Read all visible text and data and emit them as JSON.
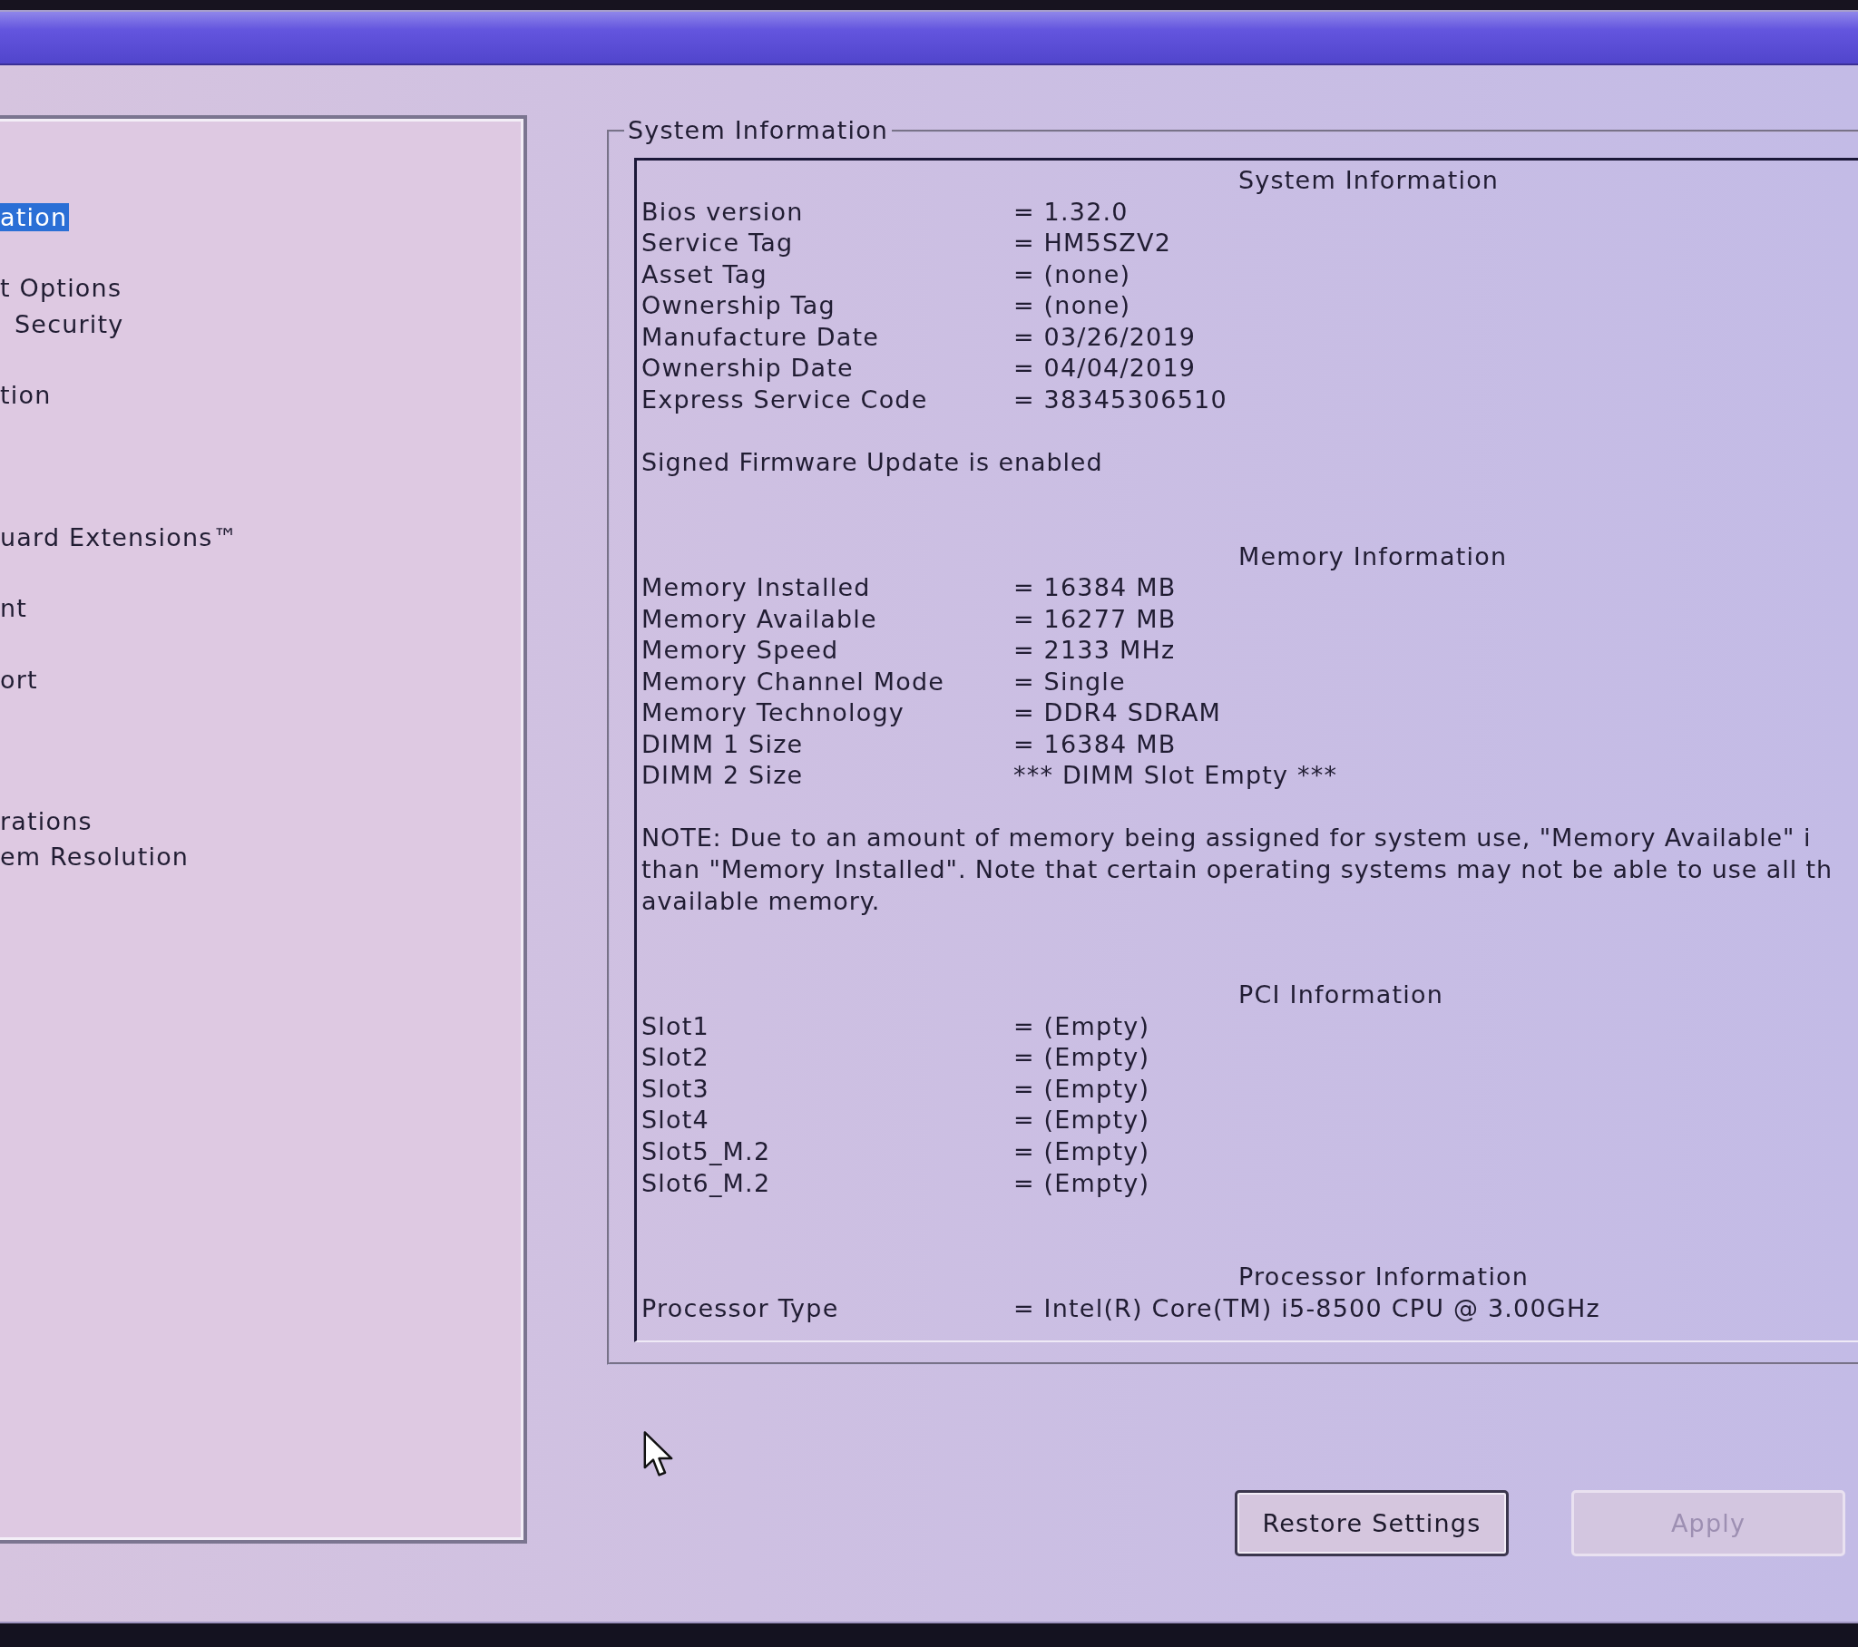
{
  "sidebar": {
    "items": [
      {
        "label": "ation",
        "selected": true
      },
      {
        "label": "t Options",
        "selected": false
      },
      {
        "label": "Security",
        "selected": false
      },
      {
        "label": "tion",
        "selected": false
      },
      {
        "label": "uard Extensions™",
        "selected": false
      },
      {
        "label": "nt",
        "selected": false
      },
      {
        "label": "ort",
        "selected": false
      },
      {
        "label": "rations",
        "selected": false
      },
      {
        "label": "em Resolution",
        "selected": false
      }
    ]
  },
  "group_box": {
    "title": "System Information",
    "sections": [
      {
        "title": "System Information",
        "rows": [
          {
            "label": "Bios version",
            "value": "= 1.32.0"
          },
          {
            "label": "Service Tag",
            "value": "= HM5SZV2"
          },
          {
            "label": "Asset Tag",
            "value": "= (none)"
          },
          {
            "label": "Ownership Tag",
            "value": "= (none)"
          },
          {
            "label": "Manufacture Date",
            "value": "= 03/26/2019"
          },
          {
            "label": "Ownership Date",
            "value": "= 04/04/2019"
          },
          {
            "label": "Express Service Code",
            "value": "= 38345306510"
          }
        ],
        "note": "Signed Firmware Update is enabled"
      },
      {
        "title": "Memory Information",
        "rows": [
          {
            "label": "Memory Installed",
            "value": "= 16384 MB"
          },
          {
            "label": "Memory Available",
            "value": "= 16277 MB"
          },
          {
            "label": "Memory Speed",
            "value": "= 2133 MHz"
          },
          {
            "label": "Memory Channel Mode",
            "value": "= Single"
          },
          {
            "label": "Memory Technology",
            "value": "= DDR4 SDRAM"
          },
          {
            "label": "DIMM 1 Size",
            "value": "= 16384 MB"
          },
          {
            "label": "DIMM 2 Size",
            "value": "*** DIMM Slot Empty ***"
          }
        ],
        "note": "NOTE: Due to an amount of memory being assigned for system use, \"Memory Available\" i\nthan \"Memory Installed\". Note that certain operating systems may not be able to use all th\navailable memory."
      },
      {
        "title": "PCI Information",
        "rows": [
          {
            "label": "Slot1",
            "value": "= (Empty)"
          },
          {
            "label": "Slot2",
            "value": "= (Empty)"
          },
          {
            "label": "Slot3",
            "value": "= (Empty)"
          },
          {
            "label": "Slot4",
            "value": "= (Empty)"
          },
          {
            "label": "Slot5_M.2",
            "value": "= (Empty)"
          },
          {
            "label": "Slot6_M.2",
            "value": "= (Empty)"
          }
        ]
      },
      {
        "title": "Processor Information",
        "rows": [
          {
            "label": "Processor Type",
            "value": "= Intel(R) Core(TM) i5-8500 CPU @ 3.00GHz"
          }
        ]
      }
    ]
  },
  "buttons": [
    {
      "label": "Restore Settings",
      "disabled": false
    },
    {
      "label": "Apply",
      "disabled": true
    }
  ]
}
